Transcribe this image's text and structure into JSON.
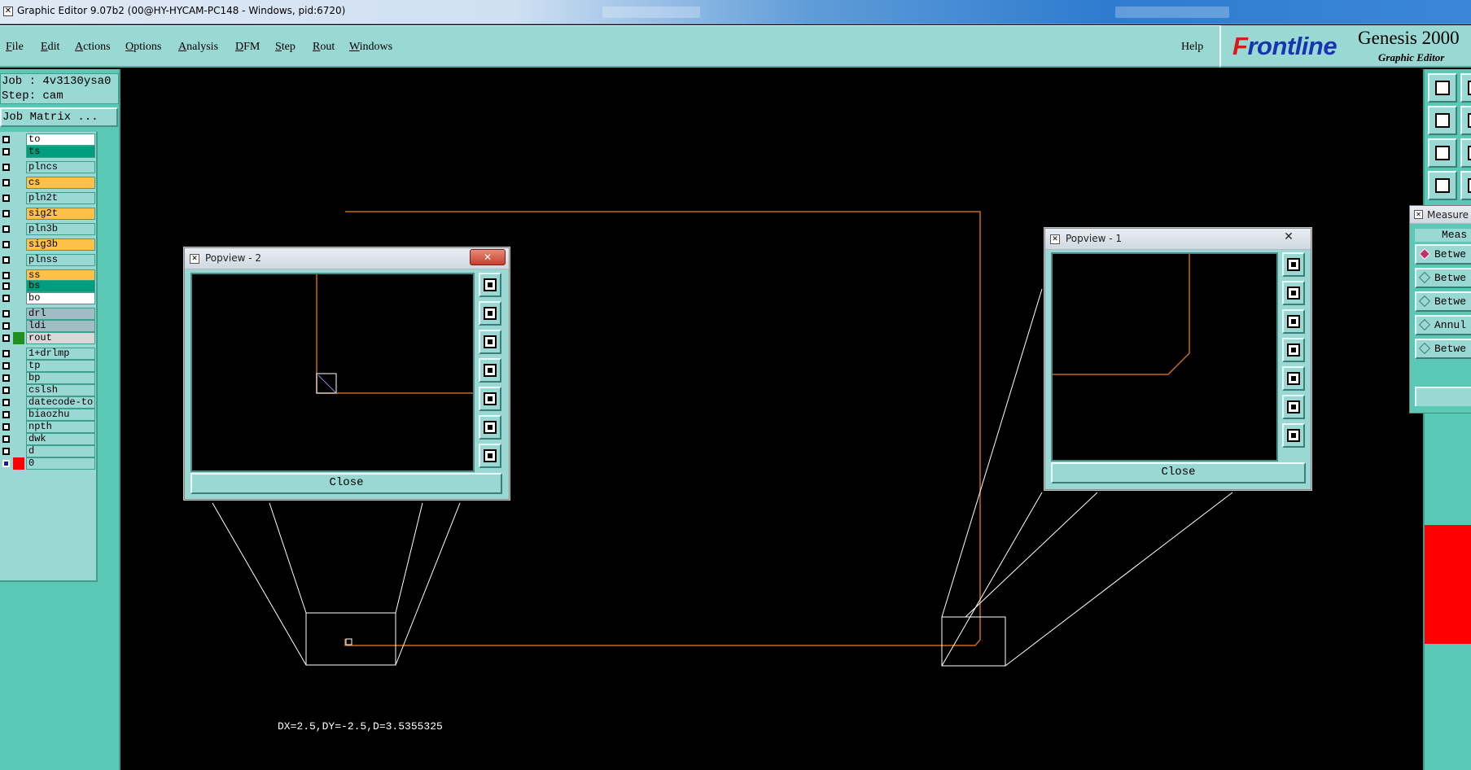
{
  "window": {
    "title": "Graphic Editor 9.07b2 (00@HY-HYCAM-PC148 - Windows, pid:6720)"
  },
  "menu": {
    "items": [
      {
        "label": "File"
      },
      {
        "label": "Edit"
      },
      {
        "label": "Actions"
      },
      {
        "label": "Options"
      },
      {
        "label": "Analysis"
      },
      {
        "label": "DFM"
      },
      {
        "label": "Step"
      },
      {
        "label": "Rout"
      },
      {
        "label": "Windows"
      }
    ],
    "help": "Help"
  },
  "brand": {
    "logo": "Frontline",
    "product": "Genesis 2000",
    "subtitle": "Graphic Editor"
  },
  "job": {
    "job_line": "Job : 4v3130ysa0",
    "step_line": "Step: cam",
    "matrix_button": "Job Matrix ..."
  },
  "layers": [
    {
      "name": "to",
      "color": "#ffffff",
      "swatch": ""
    },
    {
      "name": "ts",
      "color": "#009e7e",
      "swatch": ""
    },
    {
      "name": "plncs",
      "color": "#9ad8d4",
      "swatch": ""
    },
    {
      "name": "cs",
      "color": "#ffc04a",
      "swatch": ""
    },
    {
      "name": "pln2t",
      "color": "#9ad8d4",
      "swatch": ""
    },
    {
      "name": "sig2t",
      "color": "#ffc04a",
      "swatch": ""
    },
    {
      "name": "pln3b",
      "color": "#9ad8d4",
      "swatch": ""
    },
    {
      "name": "sig3b",
      "color": "#ffc04a",
      "swatch": ""
    },
    {
      "name": "plnss",
      "color": "#9ad8d4",
      "swatch": ""
    },
    {
      "name": "ss",
      "color": "#ffc04a",
      "swatch": ""
    },
    {
      "name": "bs",
      "color": "#009e7e",
      "swatch": ""
    },
    {
      "name": "bo",
      "color": "#ffffff",
      "swatch": ""
    },
    {
      "name": "drl",
      "color": "#a0bcc4",
      "swatch": ""
    },
    {
      "name": "ldi",
      "color": "#a0bcc4",
      "swatch": ""
    },
    {
      "name": "rout",
      "color": "#d8d8d8",
      "swatch": "#1f8f1f"
    },
    {
      "name": "1+drlmp",
      "color": "#9ad8d4",
      "swatch": ""
    },
    {
      "name": "tp",
      "color": "#9ad8d4",
      "swatch": ""
    },
    {
      "name": "bp",
      "color": "#9ad8d4",
      "swatch": ""
    },
    {
      "name": "cslsh",
      "color": "#9ad8d4",
      "swatch": ""
    },
    {
      "name": "datecode-to",
      "color": "#9ad8d4",
      "swatch": ""
    },
    {
      "name": "biaozhu",
      "color": "#9ad8d4",
      "swatch": ""
    },
    {
      "name": "npth",
      "color": "#9ad8d4",
      "swatch": ""
    },
    {
      "name": "dwk",
      "color": "#9ad8d4",
      "swatch": ""
    },
    {
      "name": "d",
      "color": "#9ad8d4",
      "swatch": ""
    },
    {
      "name": "0",
      "color": "#9ad8d4",
      "swatch": "#ff0000"
    }
  ],
  "popview2": {
    "title": "Popview - 2",
    "close_label": "Close"
  },
  "popview1": {
    "title": "Popview - 1",
    "close_label": "Close"
  },
  "measurement": "DX=2.5,DY=-2.5,D=3.5355325",
  "measure_window": {
    "title": "Measure",
    "header": "Meas",
    "options": [
      {
        "label": "Betwe",
        "selected": true
      },
      {
        "label": "Betwe",
        "selected": false
      },
      {
        "label": "Betwe",
        "selected": false
      },
      {
        "label": "Annul",
        "selected": false
      },
      {
        "label": "Betwe",
        "selected": false
      }
    ]
  },
  "colors": {
    "panel": "#9ad8d4",
    "background": "#5ac8b4",
    "profile_line": "#c86a1e"
  }
}
